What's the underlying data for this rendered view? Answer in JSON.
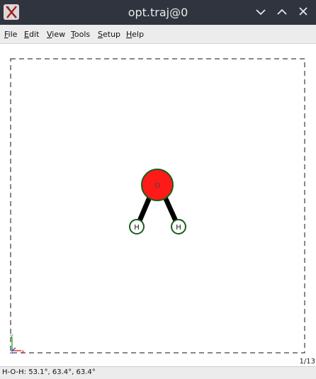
{
  "window": {
    "title": "opt.traj@0",
    "controls": [
      "minimize",
      "maximize",
      "close"
    ]
  },
  "menubar": {
    "items": [
      {
        "label": "File",
        "mnemonic": "F",
        "rest": "ile"
      },
      {
        "label": "Edit",
        "mnemonic": "E",
        "rest": "dit"
      },
      {
        "label": "View",
        "mnemonic": "V",
        "rest": "iew"
      },
      {
        "label": "Tools",
        "mnemonic": "T",
        "rest": "ools"
      },
      {
        "label": "Setup",
        "mnemonic": "S",
        "rest": "etup"
      },
      {
        "label": "Help",
        "mnemonic": "H",
        "rest": "elp"
      }
    ]
  },
  "scene": {
    "atoms": [
      {
        "symbol": "O",
        "color": "#ff1a1a",
        "outline": "#1a5e1a"
      },
      {
        "symbol": "H",
        "color": "#ffffff",
        "outline": "#1a5e1a"
      },
      {
        "symbol": "H",
        "color": "#ffffff",
        "outline": "#1a5e1a"
      }
    ],
    "bond_color": "#000000",
    "axes": {
      "x_color": "#d62020",
      "y_color": "#2aa02a",
      "z_color": "#2040d0"
    }
  },
  "frame_counter": "1/13",
  "status": {
    "text": "H-O-H: 53.1°, 63.4°, 63.4°"
  }
}
